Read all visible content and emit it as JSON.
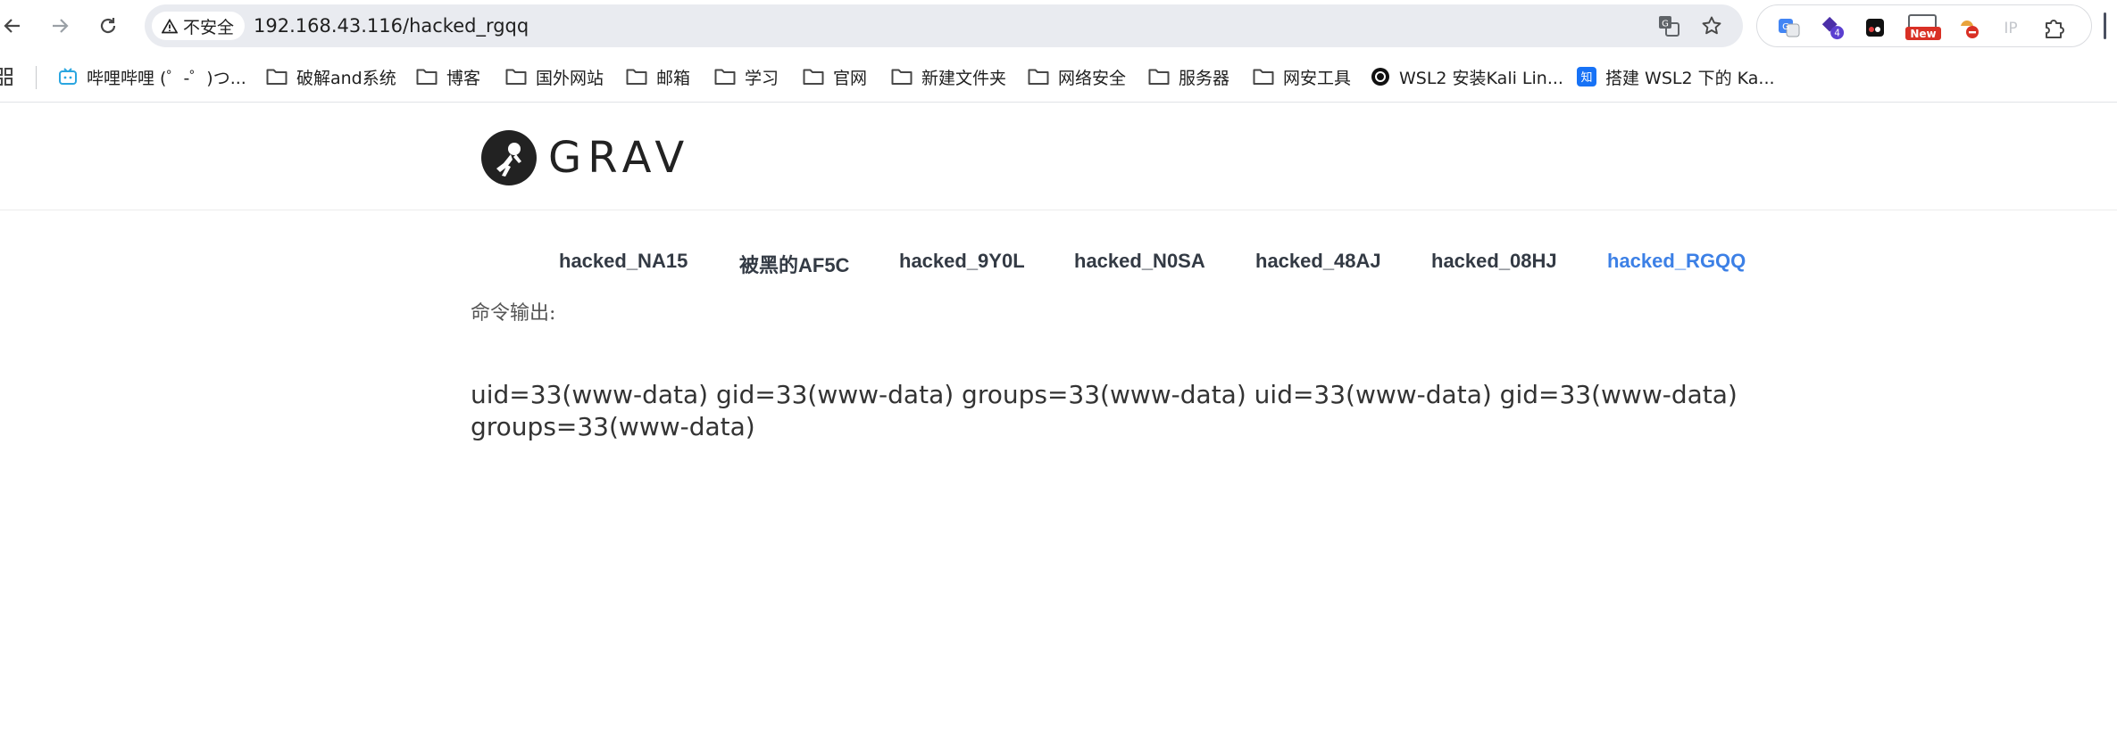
{
  "browser": {
    "security_label": "不安全",
    "url": "192.168.43.116/hacked_rgqq",
    "extensions": {
      "badge_count": "4",
      "new_badge": "New",
      "ip_label": "IP"
    }
  },
  "bookmarks": [
    {
      "label": "哔哩哔哩 (゜-゜)つ...",
      "icon": "bilibili-icon"
    },
    {
      "label": "破解and系统",
      "icon": "folder-icon"
    },
    {
      "label": "博客",
      "icon": "folder-icon"
    },
    {
      "label": "国外网站",
      "icon": "folder-icon"
    },
    {
      "label": "邮箱",
      "icon": "folder-icon"
    },
    {
      "label": "学习",
      "icon": "folder-icon"
    },
    {
      "label": "官网",
      "icon": "folder-icon"
    },
    {
      "label": "新建文件夹",
      "icon": "folder-icon"
    },
    {
      "label": "网络安全",
      "icon": "folder-icon"
    },
    {
      "label": "服务器",
      "icon": "folder-icon"
    },
    {
      "label": "网安工具",
      "icon": "folder-icon"
    },
    {
      "label": "WSL2 安装Kali Lin...",
      "icon": "circle-site-icon"
    },
    {
      "label": "搭建 WSL2 下的 Ka...",
      "icon": "zhihu-icon"
    }
  ],
  "site": {
    "logo_text": "GRAV",
    "menu": [
      {
        "label": "hacked_NA15",
        "active": false
      },
      {
        "label": "被黑的AF5C",
        "active": false
      },
      {
        "label": "hacked_9Y0L",
        "active": false
      },
      {
        "label": "hacked_N0SA",
        "active": false
      },
      {
        "label": "hacked_48AJ",
        "active": false
      },
      {
        "label": "hacked_08HJ",
        "active": false
      },
      {
        "label": "hacked_RGQQ",
        "active": true
      }
    ],
    "output_label": "命令输出:",
    "output_text": "uid=33(www-data) gid=33(www-data) groups=33(www-data) uid=33(www-data) gid=33(www-data) groups=33(www-data)"
  },
  "colors": {
    "active_menu": "#3c80e6",
    "menu_text": "#333a44",
    "omnibox_bg": "#e9ebf0"
  }
}
